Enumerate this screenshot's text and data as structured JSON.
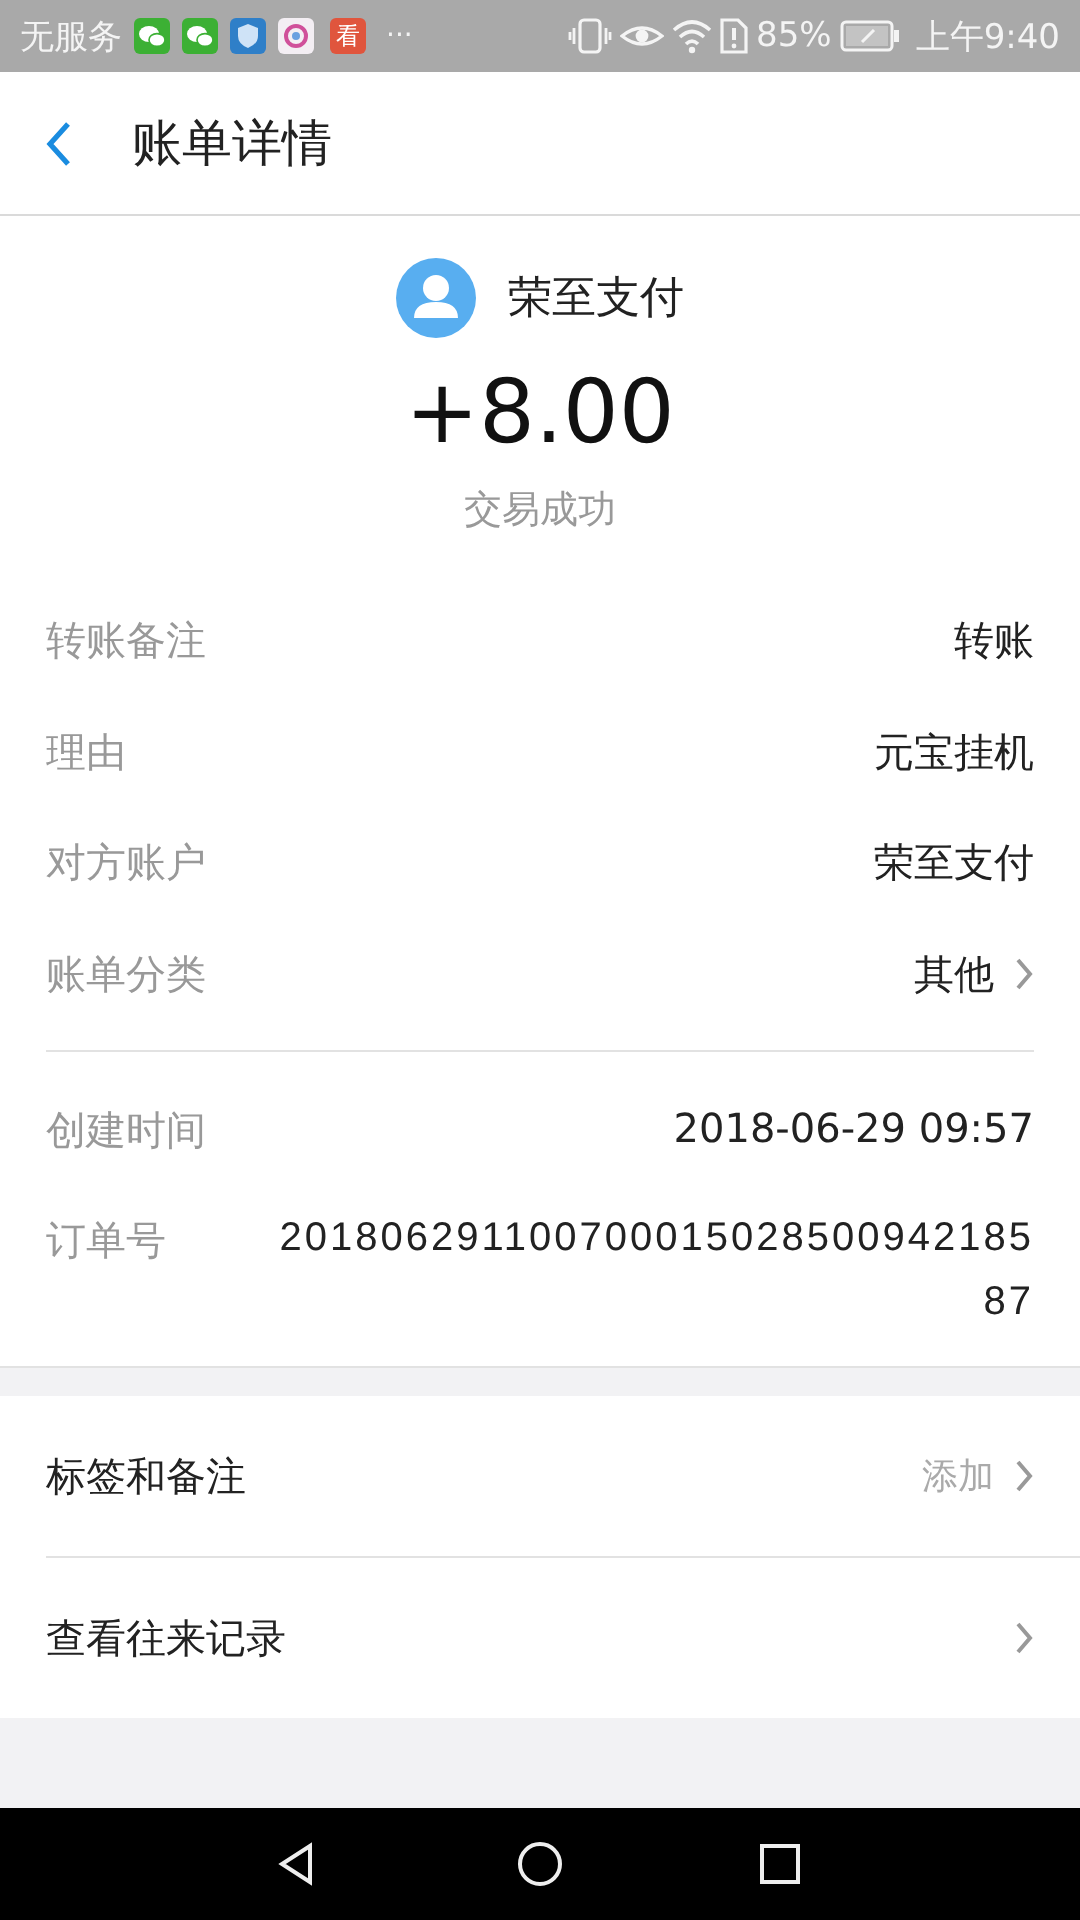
{
  "status_bar": {
    "carrier": "无服务",
    "notifications": [
      {
        "kind": "wechat"
      },
      {
        "kind": "wechat"
      },
      {
        "kind": "shield"
      },
      {
        "kind": "camera"
      },
      {
        "kind": "app",
        "label": "看"
      }
    ],
    "more": "···",
    "battery_percent": "85%",
    "time": "上午9:40"
  },
  "header": {
    "title": "账单详情"
  },
  "summary": {
    "name": "荣至支付",
    "amount": "+8.00",
    "status": "交易成功"
  },
  "details": [
    {
      "label": "转账备注",
      "value": "转账",
      "link": false
    },
    {
      "label": "理由",
      "value": "元宝挂机",
      "link": false
    },
    {
      "label": "对方账户",
      "value": "荣至支付",
      "link": false
    },
    {
      "label": "账单分类",
      "value": "其他",
      "link": true
    }
  ],
  "records": [
    {
      "label": "创建时间",
      "value": "2018-06-29 09:57",
      "kind": "time"
    },
    {
      "label": "订单号",
      "value": "20180629110070001502850094218587",
      "kind": "order"
    }
  ],
  "actions": [
    {
      "label": "标签和备注",
      "hint": "添加"
    },
    {
      "label": "查看往来记录"
    }
  ]
}
